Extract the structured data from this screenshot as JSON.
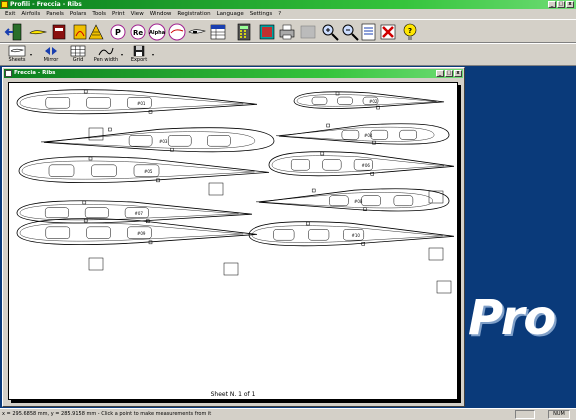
{
  "app": {
    "title": "Profili - Freccia - Ribs",
    "min_label": "_",
    "max_label": "□",
    "close_label": "x"
  },
  "menu": [
    "Exit",
    "Airfoils",
    "Panels",
    "Polars",
    "Tools",
    "Print",
    "View",
    "Window",
    "Registration",
    "Language",
    "Settings",
    "?"
  ],
  "toolbar2": {
    "sheets_label": "Sheets",
    "mirror_label": "Mirror",
    "grid_label": "Grid",
    "pen_width_label": "Pen width",
    "export_label": "Export"
  },
  "child": {
    "title": "Freccia - Ribs",
    "sheet_label": "Sheet N. 1 of 1"
  },
  "ribs": [
    {
      "label": "#01"
    },
    {
      "label": "#02"
    },
    {
      "label": "#03"
    },
    {
      "label": "#04"
    },
    {
      "label": "#05"
    },
    {
      "label": "#06"
    },
    {
      "label": "#07"
    },
    {
      "label": "#08"
    },
    {
      "label": "#09"
    },
    {
      "label": "#10"
    }
  ],
  "branding": {
    "logo_text": "Pro"
  },
  "status": {
    "message": "x = 295.6858 mm, y = 285.9158 mm - Click a point to make measurements from it",
    "num": "NUM"
  },
  "colors": {
    "title_green": "#35c43c",
    "mdi_background": "#0a3a7a",
    "face": "#d4d0c8"
  }
}
